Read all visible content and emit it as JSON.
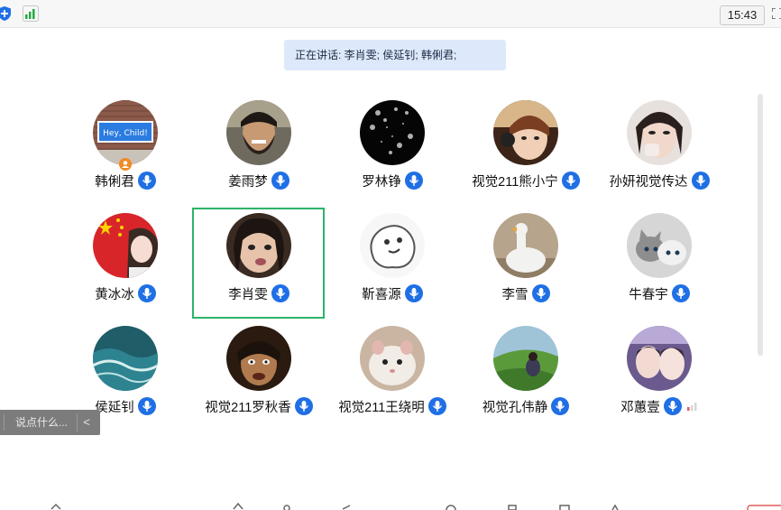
{
  "window": {
    "clock": "15:43"
  },
  "banner": {
    "speaking_text": "正在讲话: 李肖雯; 侯延钊; 韩俐君;"
  },
  "participants": [
    {
      "name": "韩俐君",
      "avatar": "sign-photo",
      "host": true
    },
    {
      "name": "姜雨梦",
      "avatar": "bearded-man"
    },
    {
      "name": "罗林铮",
      "avatar": "dark-sparkles"
    },
    {
      "name": "视觉211熊小宁",
      "avatar": "girl-headphones"
    },
    {
      "name": "孙妍视觉传达",
      "avatar": "girl-portrait"
    },
    {
      "name": "黄冰冰",
      "avatar": "flag-girl"
    },
    {
      "name": "李肖雯",
      "avatar": "girl-closeup",
      "selected": true
    },
    {
      "name": "靳喜源",
      "avatar": "sketch-ghost"
    },
    {
      "name": "李雪",
      "avatar": "white-goose"
    },
    {
      "name": "牛春宇",
      "avatar": "grey-cat"
    },
    {
      "name": "侯延钊",
      "avatar": "sea-waves"
    },
    {
      "name": "视觉211罗秋香",
      "avatar": "movie-man"
    },
    {
      "name": "视觉211王绕明",
      "avatar": "hamster"
    },
    {
      "name": "视觉孔伟静",
      "avatar": "green-hill"
    },
    {
      "name": "邓蕙壹",
      "avatar": "two-girls",
      "signal_bars": true
    }
  ],
  "chat": {
    "placeholder": "说点什么...",
    "collapse": "<"
  },
  "colors": {
    "mic_blue": "#1f6fe5",
    "selected_border": "#2db36a",
    "banner_bg": "#dde9fb",
    "signal_green": "#22aa44"
  }
}
